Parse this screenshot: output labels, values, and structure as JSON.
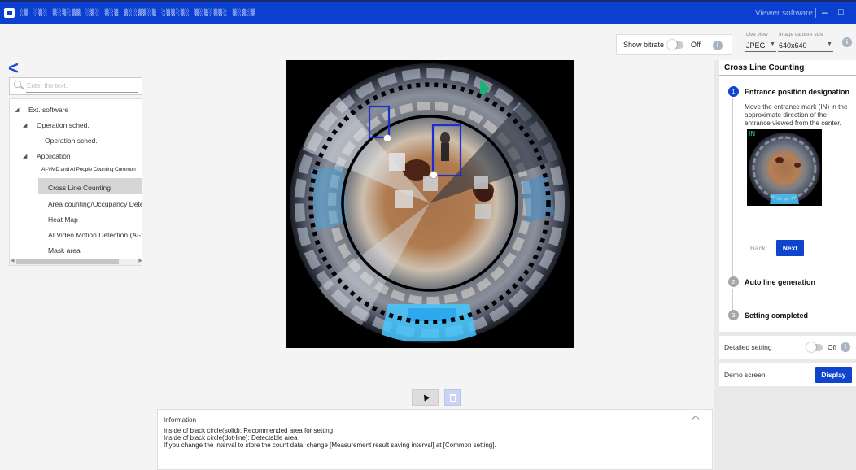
{
  "titlebar": {
    "scrambled_title": "░▒ ░▒░ ▒░▒░▒▒ ░▒░ ▒░▒ ▒░░▒▒░▒ ░▒▒░▒░ ▒░▒░▒▒░ ▒░▒░▒",
    "app_name": "Viewer software",
    "minimize": "–",
    "maximize": "□"
  },
  "top_controls": {
    "show_bitrate_label": "Show bitrate",
    "show_bitrate_state": "Off",
    "live_view_label": "Live view",
    "live_view_value": "JPEG",
    "capture_size_label": "Image capture size",
    "capture_size_value": "640x640"
  },
  "sidebar": {
    "back_glyph": "<",
    "search_placeholder": "Enter the text.",
    "tree": [
      {
        "label": "Ext. software",
        "expanded": true
      },
      {
        "label": "Operation sched.",
        "expanded": true
      },
      {
        "label": "Operation sched."
      },
      {
        "label": "Application",
        "expanded": true
      },
      {
        "label": "AI-VMD and AI People Counting Common"
      },
      {
        "label": "Cross Line Counting",
        "selected": true
      },
      {
        "label": "Area counting/Occupancy Detecti"
      },
      {
        "label": "Heat Map"
      },
      {
        "label": "AI Video Motion Detection (AI-VM"
      },
      {
        "label": "Mask area"
      }
    ]
  },
  "camera_view": {
    "entrance_mark": "IN",
    "entrance_mark_color": "#1fb07a",
    "person_box_color": "#1a2fd0"
  },
  "information": {
    "title": "Information",
    "lines": [
      "Inside of black circle(solid): Recommended area for setting",
      "Inside of black circle(dot-line): Detectable area",
      " If you change the interval to store the count data, change [Measurement result saving interval] at [Common setting]."
    ]
  },
  "wizard": {
    "title": "Cross Line Counting",
    "steps": [
      {
        "number": "1",
        "title": "Entrance position designation",
        "status": "active"
      },
      {
        "number": "2",
        "title": "Auto line generation",
        "status": "idle"
      },
      {
        "number": "3",
        "title": "Setting completed",
        "status": "idle"
      }
    ],
    "step1_description": "Move the entrance mark (IN) in the approximate direction of the entrance viewed from the center.",
    "thumb_mark": "IN",
    "back_label": "Back",
    "next_label": "Next"
  },
  "detailed_setting": {
    "label": "Detailed setting",
    "state": "Off"
  },
  "demo_screen": {
    "label": "Demo screen",
    "button": "Display"
  },
  "colors": {
    "accent": "#0f44cc",
    "titlebar": "#0a3fd0"
  }
}
